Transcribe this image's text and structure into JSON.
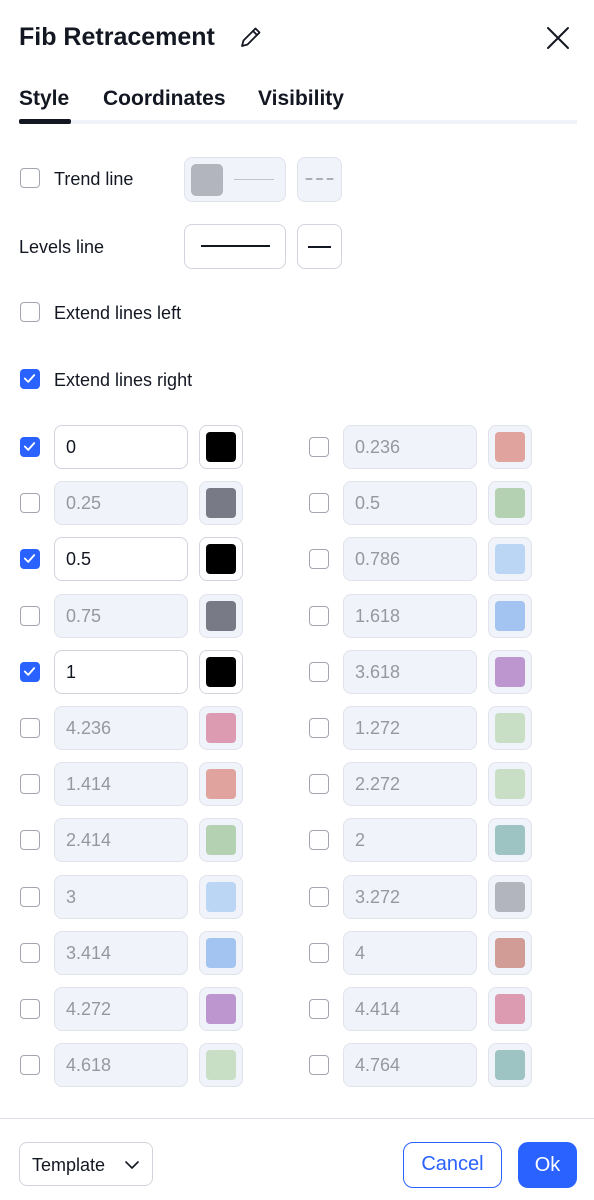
{
  "dialog": {
    "title": "Fib Retracement"
  },
  "tabs": [
    {
      "label": "Style",
      "active": true
    },
    {
      "label": "Coordinates",
      "active": false
    },
    {
      "label": "Visibility",
      "active": false
    }
  ],
  "style": {
    "trend_line": {
      "label": "Trend line",
      "checked": false,
      "color": "#b2b5be"
    },
    "levels_line": {
      "label": "Levels line"
    },
    "extend_left": {
      "label": "Extend lines left",
      "checked": false
    },
    "extend_right": {
      "label": "Extend lines right",
      "checked": true
    }
  },
  "levels_left": [
    {
      "value": "0",
      "enabled": true,
      "color": "#000000"
    },
    {
      "value": "0.25",
      "enabled": false,
      "color": "#787b86"
    },
    {
      "value": "0.5",
      "enabled": true,
      "color": "#000000"
    },
    {
      "value": "0.75",
      "enabled": false,
      "color": "#787b86"
    },
    {
      "value": "1",
      "enabled": true,
      "color": "#000000"
    },
    {
      "value": "4.236",
      "enabled": false,
      "color": "#dc9bb0"
    },
    {
      "value": "1.414",
      "enabled": false,
      "color": "#e0a39d"
    },
    {
      "value": "2.414",
      "enabled": false,
      "color": "#b4d1b1"
    },
    {
      "value": "3",
      "enabled": false,
      "color": "#bbd6f4"
    },
    {
      "value": "3.414",
      "enabled": false,
      "color": "#a3c4f0"
    },
    {
      "value": "4.272",
      "enabled": false,
      "color": "#bd95cf"
    },
    {
      "value": "4.618",
      "enabled": false,
      "color": "#c8dfc6"
    }
  ],
  "levels_right": [
    {
      "value": "0.236",
      "enabled": false,
      "color": "#e0a39d"
    },
    {
      "value": "0.5",
      "enabled": false,
      "color": "#b4d1b1"
    },
    {
      "value": "0.786",
      "enabled": false,
      "color": "#bbd6f4"
    },
    {
      "value": "1.618",
      "enabled": false,
      "color": "#a3c4f0"
    },
    {
      "value": "3.618",
      "enabled": false,
      "color": "#bd95cf"
    },
    {
      "value": "1.272",
      "enabled": false,
      "color": "#c8dfc6"
    },
    {
      "value": "2.272",
      "enabled": false,
      "color": "#c8dfc6"
    },
    {
      "value": "2",
      "enabled": false,
      "color": "#9dc4c3"
    },
    {
      "value": "3.272",
      "enabled": false,
      "color": "#b2b5be"
    },
    {
      "value": "4",
      "enabled": false,
      "color": "#d19b96"
    },
    {
      "value": "4.414",
      "enabled": false,
      "color": "#dc9bb0"
    },
    {
      "value": "4.764",
      "enabled": false,
      "color": "#9dc4c3"
    }
  ],
  "footer": {
    "template_label": "Template",
    "cancel_label": "Cancel",
    "ok_label": "Ok"
  }
}
